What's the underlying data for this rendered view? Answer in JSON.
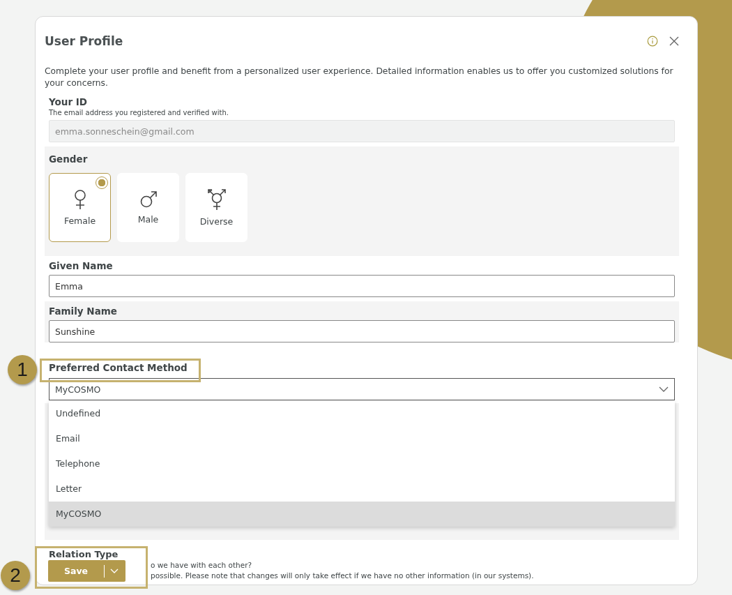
{
  "window": {
    "title": "User Profile"
  },
  "intro": "Complete your user profile and benefit from a personalized user experience. Detailed information enables us to offer you customized solutions for your concerns.",
  "your_id": {
    "label": "Your ID",
    "hint": "The email address you registered and verified with.",
    "value": "emma.sonneschein@gmail.com",
    "disabled": true
  },
  "gender": {
    "label": "Gender",
    "options": [
      {
        "label": "Female",
        "kind": "female",
        "selected": true
      },
      {
        "label": "Male",
        "kind": "male",
        "selected": false
      },
      {
        "label": "Diverse",
        "kind": "diverse",
        "selected": false
      }
    ]
  },
  "given_name": {
    "label": "Given Name",
    "value": "Emma"
  },
  "family_name": {
    "label": "Family Name",
    "value": "Sunshine"
  },
  "contact_method": {
    "label": "Preferred Contact Method",
    "value": "MyCOSMO",
    "expanded": true,
    "options": [
      {
        "label": "Undefined",
        "selected": false
      },
      {
        "label": "Email",
        "selected": false
      },
      {
        "label": "Telephone",
        "selected": false
      },
      {
        "label": "Letter",
        "selected": false
      },
      {
        "label": "MyCOSMO",
        "selected": true
      }
    ]
  },
  "relation_type": {
    "label": "Relation Type",
    "lines": [
      "o we have with each other?",
      "possible. Please note that changes will only take effect if we have no other information (in our systems)."
    ]
  },
  "save_button": {
    "label": "Save"
  },
  "annotations": [
    "1",
    "2"
  ]
}
